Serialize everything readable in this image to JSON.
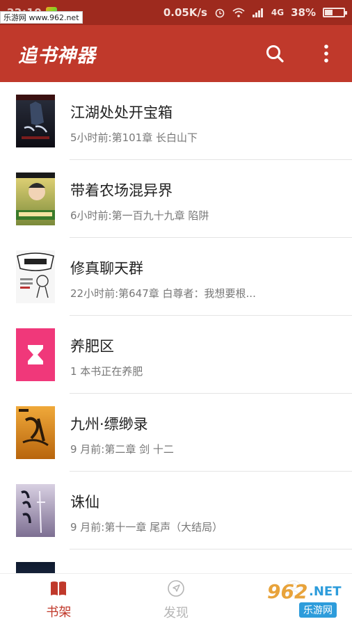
{
  "status_bar": {
    "time": "22:10",
    "network_speed": "0.05K/s",
    "signal_type": "4G",
    "battery": "38%",
    "battery_level": 0.38,
    "icons": [
      "alarm-icon",
      "wifi-icon",
      "signal-icon",
      "battery-icon"
    ]
  },
  "watermark_top": "乐游网 www.962.net",
  "app_bar": {
    "title": "追书神器",
    "icons": [
      "search-icon",
      "more-vert-icon"
    ]
  },
  "books": [
    {
      "title": "江湖处处开宝箱",
      "subtitle": "5小时前:第101章 长白山下",
      "cover_color": "#1b1b24"
    },
    {
      "title": "带着农场混异界",
      "subtitle": "6小时前:第一百九十九章 陷阱",
      "cover_color": "#c9b25a"
    },
    {
      "title": "修真聊天群",
      "subtitle": "22小时前:第647章 白尊者：我想要根...",
      "cover_color": "#f2f2f2"
    },
    {
      "title": "养肥区",
      "subtitle": "1 本书正在养肥",
      "cover_color": "#f0387a"
    },
    {
      "title": "九州·缥缈录",
      "subtitle": "9 月前:第二章 剑 十二",
      "cover_color": "#d48a1e"
    },
    {
      "title": "诛仙",
      "subtitle": "9 月前:第十一章 尾声（大结局）",
      "cover_color": "#a99bb8"
    }
  ],
  "bottom_nav": {
    "items": [
      {
        "label": "书架",
        "icon": "book-icon",
        "active": true
      },
      {
        "label": "发现",
        "icon": "compass-icon",
        "active": false
      },
      {
        "label": "",
        "icon": "user-icon",
        "active": false
      }
    ]
  },
  "watermark_logo": {
    "big": "962",
    "net": ".NET",
    "bar": "乐游网"
  },
  "colors": {
    "accent": "#c0392b",
    "status_bar": "#9e2a1e"
  }
}
